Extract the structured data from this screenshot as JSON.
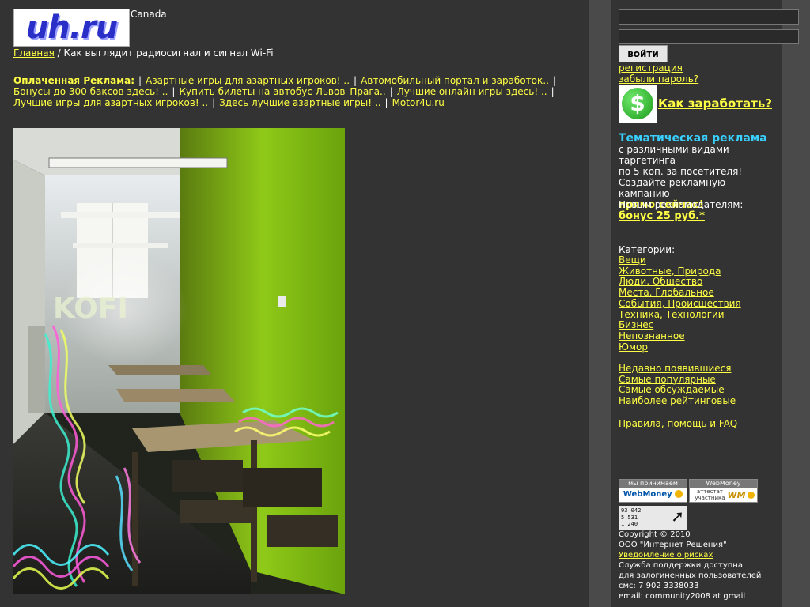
{
  "header": {
    "logo_text": "uh.ru",
    "region": "Canada"
  },
  "breadcrumb": {
    "home": "Главная",
    "separator": "/",
    "current": "Как выглядит радиосигнал и сигнал Wi-Fi"
  },
  "ads": {
    "title": "Оплаченная Реклама:",
    "links": [
      "Азартные игры для азартных игроков! ..",
      "Автомобильный портал и заработок..",
      "Бонусы до 300 баксов здесь! ..",
      "Купить билеты на автобус Львов–Прага..",
      "Лучшие онлайн игры здесь! ..",
      "Лучшие игры для азартных игроков! ..",
      "Здесь лучшие азартные игры! ..",
      "Motor4u.ru"
    ]
  },
  "photo": {
    "wall_text": "KOFI"
  },
  "sidebar": {
    "login_button": "войти",
    "register_link": "регистрация",
    "forgot_link": "забыли пароль?",
    "earn_link": "Как заработать?",
    "promo_title": "Тематическая реклама",
    "promo_lines": [
      "с различными видами таргетинга",
      "по 5 коп. за посетителя!",
      "Создайте рекламную кампанию"
    ],
    "promo_cta": "прямо сейчас!",
    "new_adv_label": "Новым рекламодателям:",
    "bonus_link": "бонус 25 руб.*",
    "categories_label": "Категории:",
    "categories": [
      "Вещи",
      "Животные, Природа",
      "Люди, Общество",
      "Места, Глобальное",
      "События, Происшествия",
      "Техника, Технологии",
      "Бизнес",
      "Непознанное",
      "Юмор"
    ],
    "lists": [
      "Недавно появившиеся",
      "Самые популярные",
      "Самые обсуждаемые",
      "Наиболее рейтинговые"
    ],
    "rules_link": "Правила, помощь и FAQ",
    "badge1_top": "мы принимаем",
    "badge1_text": "WebMoney",
    "badge2_top": "WebMoney",
    "badge2_text": "аттестат участника",
    "counter_lines": [
      "93 042",
      "5 531",
      "1 240"
    ],
    "copyright": "Copyright © 2010",
    "company": "ООО \"Интернет Решения\"",
    "risk_link": "Уведомление о рисках",
    "support_line1": "Служба поддержки доступна",
    "support_line2": "для залогиненных пользователей",
    "sms": "смс: 7 902 3338033",
    "email": "email: community2008 at gmail"
  },
  "colors": {
    "page_bg": "#4a4a4a",
    "panel_bg": "#333333",
    "link": "#ffff44",
    "accent_cyan": "#38d0ff"
  }
}
